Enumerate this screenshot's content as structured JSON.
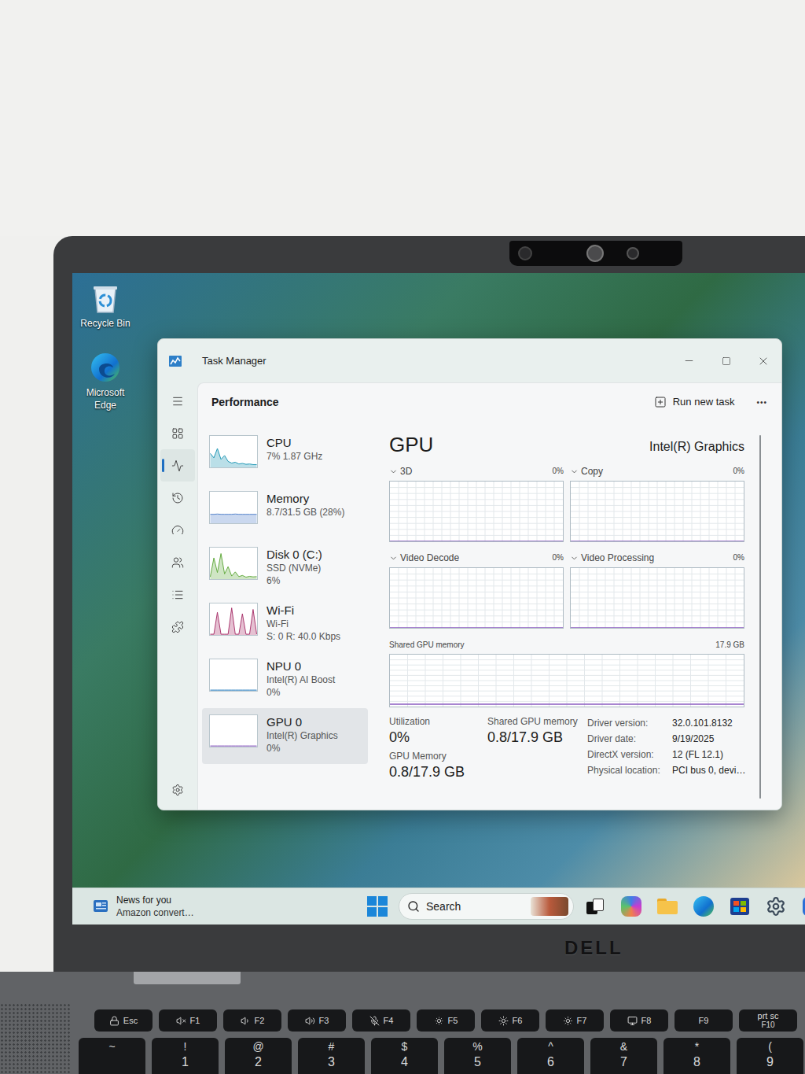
{
  "laptop": {
    "logo": "DELL"
  },
  "desktop": {
    "icons": [
      {
        "label": "Recycle Bin",
        "kind": "recycle"
      },
      {
        "label": "Microsoft Edge",
        "kind": "edge"
      }
    ]
  },
  "window": {
    "title": "Task Manager"
  },
  "nav": [
    {
      "kind": "menu",
      "selected": false
    },
    {
      "kind": "processes",
      "selected": false
    },
    {
      "kind": "performance",
      "selected": true
    },
    {
      "kind": "history",
      "selected": false
    },
    {
      "kind": "startup",
      "selected": false
    },
    {
      "kind": "users",
      "selected": false
    },
    {
      "kind": "details",
      "selected": false
    },
    {
      "kind": "services",
      "selected": false
    },
    {
      "kind": "settings",
      "selected": false
    }
  ],
  "header": {
    "title": "Performance",
    "action": "Run new task",
    "more": "•••"
  },
  "sidebar": [
    {
      "name": "CPU",
      "details": [
        "7% 1.87 GHz"
      ],
      "values": [
        45,
        30,
        62,
        25,
        38,
        18,
        12,
        15,
        9,
        11,
        8,
        9,
        7,
        7
      ],
      "color": "#1a95b3",
      "selected": false
    },
    {
      "name": "Memory",
      "details": [
        "8.7/31.5 GB (28%)"
      ],
      "values": [
        28,
        28,
        29,
        28,
        28,
        28,
        28,
        29,
        28,
        28,
        28,
        28,
        28,
        28
      ],
      "color": "#4f7fc9",
      "selected": false
    },
    {
      "name": "Disk 0 (C:)",
      "details": [
        "SSD (NVMe)",
        "6%"
      ],
      "values": [
        5,
        70,
        20,
        85,
        15,
        40,
        8,
        22,
        6,
        10,
        4,
        7,
        5,
        6
      ],
      "color": "#5fa83a",
      "selected": false
    },
    {
      "name": "Wi-Fi",
      "details": [
        "Wi-Fi",
        "S: 0 R: 40.0 Kbps"
      ],
      "values": [
        0,
        0,
        75,
        0,
        0,
        0,
        90,
        0,
        0,
        70,
        0,
        0,
        85,
        0
      ],
      "color": "#a8326a",
      "selected": false
    },
    {
      "name": "NPU 0",
      "details": [
        "Intel(R) AI Boost",
        "0%"
      ],
      "values": [
        0,
        0,
        0,
        0,
        0,
        0,
        0,
        0,
        0,
        0,
        0,
        0,
        0,
        0
      ],
      "color": "#2a7fc0",
      "selected": false
    },
    {
      "name": "GPU 0",
      "details": [
        "Intel(R) Graphics",
        "0%"
      ],
      "values": [
        0,
        0,
        0,
        0,
        0,
        0,
        0,
        0,
        0,
        0,
        0,
        0,
        0,
        0
      ],
      "color": "#8b5cc0",
      "selected": true
    }
  ],
  "gpu": {
    "title": "GPU",
    "adapter": "Intel(R) Graphics",
    "engines": [
      {
        "label": "3D",
        "reading": "0%",
        "values": [
          0,
          0,
          0,
          0,
          0,
          0,
          0,
          0,
          0,
          0,
          0,
          0
        ]
      },
      {
        "label": "Copy",
        "reading": "0%",
        "values": [
          0,
          0,
          0,
          0,
          0,
          0,
          0,
          0,
          0,
          0,
          0,
          0
        ]
      },
      {
        "label": "Video Decode",
        "reading": "0%",
        "values": [
          0,
          0,
          0,
          0,
          0,
          0,
          0,
          0,
          0,
          0,
          0,
          0
        ]
      },
      {
        "label": "Video Processing",
        "reading": "0%",
        "values": [
          0,
          0,
          0,
          0,
          0,
          0,
          0,
          0,
          0,
          0,
          0,
          0
        ]
      }
    ],
    "shared_chart": {
      "label": "Shared GPU memory",
      "max": "17.9 GB",
      "values": [
        0.8,
        0.8,
        0.8,
        0.8,
        0.8,
        0.8,
        0.8,
        0.8,
        0.8,
        0.8,
        0.8,
        0.8
      ],
      "color": "#8b5cc0"
    },
    "stats": [
      {
        "label": "Utilization",
        "value": "0%"
      },
      {
        "label": "Shared GPU memory",
        "value": "0.8/17.9 GB"
      },
      {
        "label": "GPU Memory",
        "value": "0.8/17.9 GB"
      }
    ],
    "details": [
      {
        "label": "Driver version:",
        "value": "32.0.101.8132"
      },
      {
        "label": "Driver date:",
        "value": "9/19/2025"
      },
      {
        "label": "DirectX version:",
        "value": "12 (FL 12.1)"
      },
      {
        "label": "Physical location:",
        "value": "PCI bus 0, devi…"
      }
    ]
  },
  "taskbar": {
    "news_title": "News for you",
    "news_subtitle": "Amazon convert…",
    "search": "Search"
  },
  "keyboard": {
    "function_row": [
      {
        "label": "Esc",
        "kind": "esc"
      },
      {
        "label": "F1",
        "kind": "mute"
      },
      {
        "label": "F2",
        "kind": "vol-down"
      },
      {
        "label": "F3",
        "kind": "vol-up"
      },
      {
        "label": "F4",
        "kind": "mic"
      },
      {
        "label": "F5",
        "kind": "dim"
      },
      {
        "label": "F6",
        "kind": "bright"
      },
      {
        "label": "F7",
        "kind": "backlight"
      },
      {
        "label": "F8",
        "kind": "display"
      },
      {
        "label": "F9",
        "kind": "plain"
      },
      {
        "label": "F10",
        "top": "prt sc",
        "kind": "plain"
      }
    ],
    "number_row": [
      {
        "top": "~"
      },
      {
        "top": "!",
        "label": "1"
      },
      {
        "top": "@",
        "label": "2"
      },
      {
        "top": "#",
        "label": "3"
      },
      {
        "top": "$",
        "label": "4"
      },
      {
        "top": "%",
        "label": "5"
      },
      {
        "top": "^",
        "label": "6"
      },
      {
        "top": "&",
        "label": "7"
      },
      {
        "top": "*",
        "label": "8"
      },
      {
        "top": "(",
        "label": "9"
      }
    ]
  }
}
